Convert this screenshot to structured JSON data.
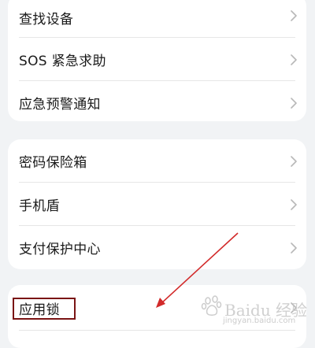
{
  "group1": {
    "items": [
      {
        "label": "查找设备"
      },
      {
        "label": "SOS 紧急求助"
      },
      {
        "label": "应急预警通知"
      }
    ]
  },
  "group2": {
    "items": [
      {
        "label": "密码保险箱"
      },
      {
        "label": "手机盾"
      },
      {
        "label": "支付保护中心"
      }
    ]
  },
  "group3": {
    "items": [
      {
        "label": "应用锁"
      }
    ]
  },
  "watermark": {
    "text": "Baidu 经验",
    "url": "jingyan.baidu.com"
  },
  "annotation": {
    "arrow_color": "#d22a2a",
    "box_color": "#7a1414"
  }
}
